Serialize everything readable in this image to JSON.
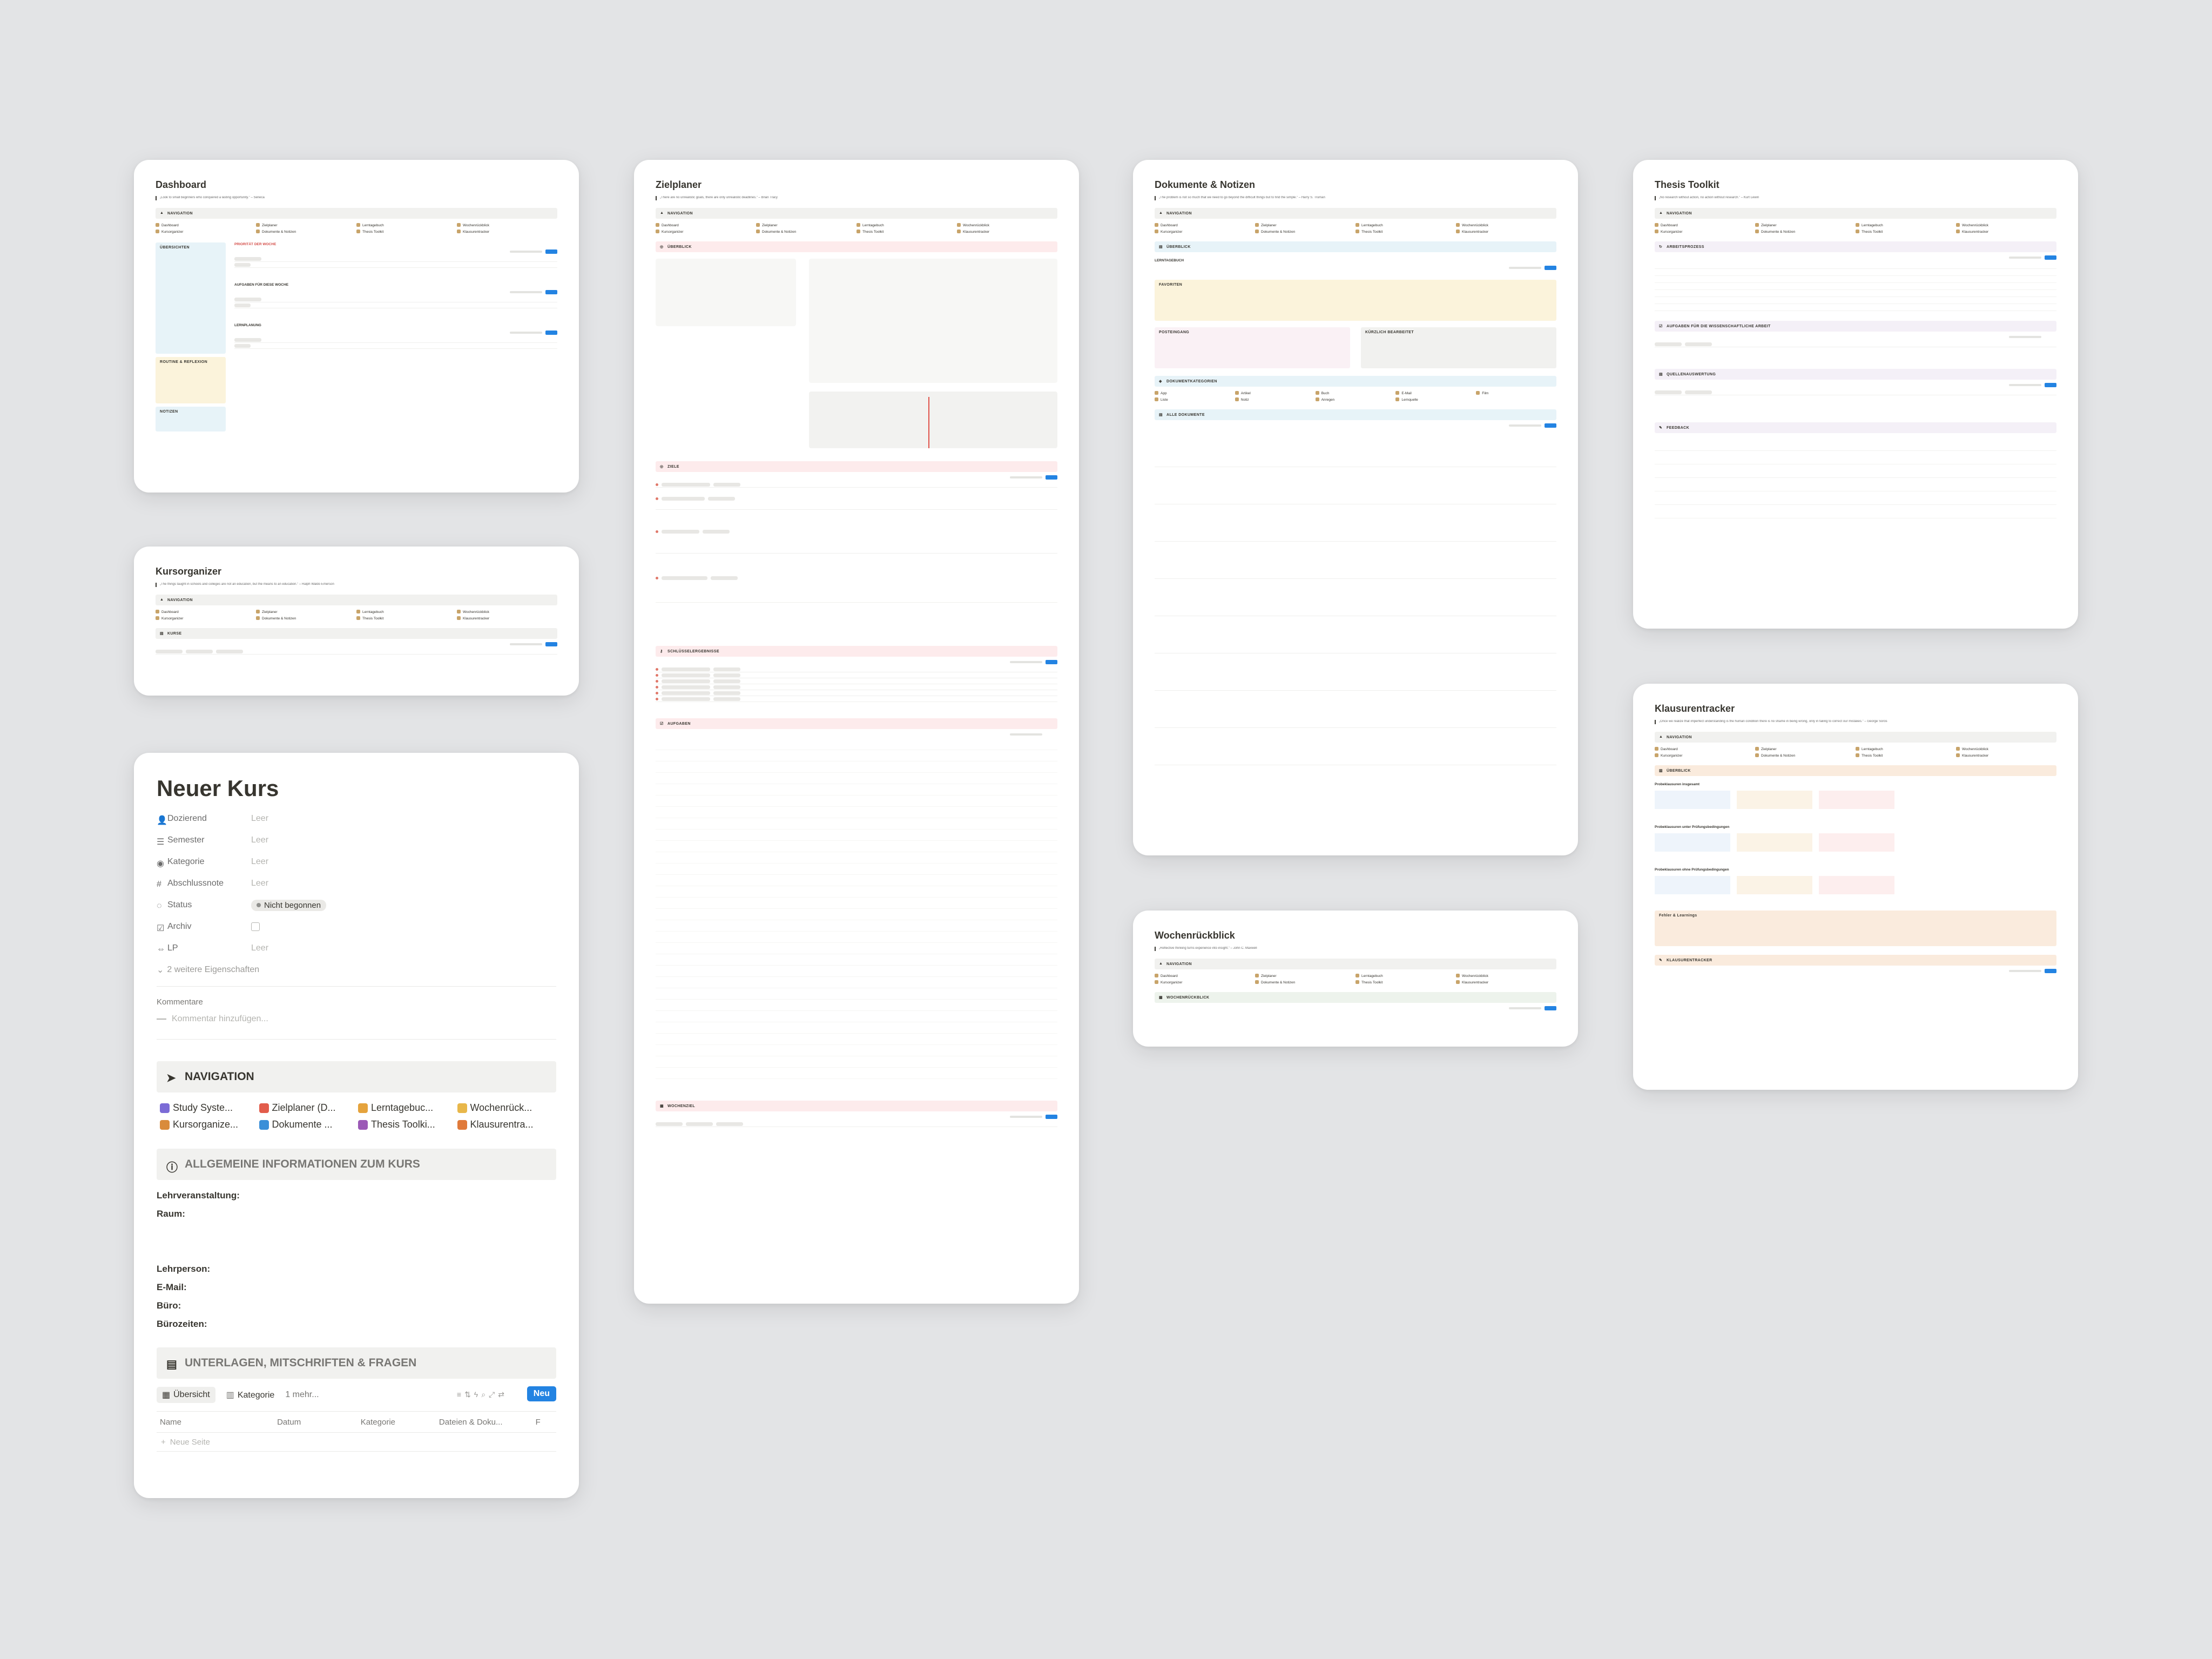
{
  "navigation_labels": [
    "Dashboard",
    "Zielplaner",
    "Lerntagebuch",
    "Wochenrückblick",
    "Kursorganizer",
    "Dokumente & Notizen",
    "Thesis Toolkit",
    "Klausurentracker"
  ],
  "cards": {
    "dashboard": {
      "title": "Dashboard",
      "quote": "„Look to small beginners who conquered a lasting opportunity.\" – Seneca",
      "nav_band": "NAVIGATION",
      "section_prio": "PRIORITÄT DER WOCHE",
      "section_tasks": "AUFGABEN FÜR DIESE WOCHE",
      "section_study": "LERNPLANUNG",
      "sidebar_a": "ÜBERSICHTEN",
      "sidebar_b": "ROUTINE & REFLEXION",
      "sidebar_c": "NOTIZEN"
    },
    "kursorganizer": {
      "title": "Kursorganizer",
      "quote": "„The things taught in schools and colleges are not an education, but the means to an education.\" – Ralph Waldo Emerson",
      "nav_band": "NAVIGATION",
      "section": "KURSE"
    },
    "neuer_kurs": {
      "title": "Neuer Kurs",
      "properties": [
        {
          "key": "Dozierend",
          "value": "Leer"
        },
        {
          "key": "Semester",
          "value": "Leer"
        },
        {
          "key": "Kategorie",
          "value": "Leer"
        },
        {
          "key": "Abschlussnote",
          "value": "Leer"
        },
        {
          "key": "Status",
          "value": "Nicht begonnen"
        },
        {
          "key": "Archiv",
          "value": ""
        },
        {
          "key": "LP",
          "value": "Leer"
        }
      ],
      "more_props": "2 weitere Eigenschaften",
      "comments_label": "Kommentare",
      "comment_placeholder": "Kommentar hinzufügen...",
      "nav_title": "NAVIGATION",
      "nav_items": [
        "Study Syste...",
        "Zielplaner (D...",
        "Lerntagebuc...",
        "Wochenrück...",
        "Kursorganize...",
        "Dokumente ...",
        "Thesis Toolki...",
        "Klausurentra..."
      ],
      "info_title": "ALLGEMEINE INFORMATIONEN ZUM KURS",
      "info_lines": [
        "Lehrveranstaltung:",
        "Raum:",
        "",
        "",
        "Lehrperson:",
        "E-Mail:",
        "Büro:",
        "Bürozeiten:"
      ],
      "docs_title": "UNTERLAGEN, MITSCHRIFTEN & FRAGEN",
      "tab_overview": "Übersicht",
      "tab_category": "Kategorie",
      "tab_more": "1 mehr...",
      "new_button": "Neu",
      "columns": [
        "Name",
        "Datum",
        "Kategorie",
        "Dateien & Doku...",
        "F"
      ],
      "new_page": "Neue Seite"
    },
    "zielplaner": {
      "title": "Zielplaner",
      "quote": "„There are no unrealistic goals, there are only unrealistic deadlines.\" – Brian Tracy",
      "nav_band": "NAVIGATION",
      "section_overview": "ÜBERBLICK",
      "section_goals": "ZIELE",
      "section_milestones": "SCHLÜSSELERGEBNISSE",
      "section_tasks": "AUFGABEN",
      "section_habits": "WOCHENZIEL"
    },
    "dokumente": {
      "title": "Dokumente & Notizen",
      "quote": "„The problem is not so much that we need to go beyond the difficult things but to find the simple.\" – Harry S. Truman",
      "nav_band": "NAVIGATION",
      "section_overview": "ÜBERBLICK",
      "sub_learning": "LERNTAGEBUCH",
      "sub_favorites": "FAVORITEN",
      "sub_inbox": "POSTEINGANG",
      "sub_recent": "KÜRZLICH BEARBEITET",
      "section_types": "DOKUMENTKATEGORIEN",
      "section_all": "ALLE DOKUMENTE",
      "groups": [
        "App",
        "Artikel",
        "Buch",
        "E-Mail",
        "Film",
        "Liste",
        "Notiz",
        "Anregen",
        "Lernquelle",
        "Lernquelle"
      ]
    },
    "wochen": {
      "title": "Wochenrückblick",
      "quote": "„Reflective thinking turns experience into insight.\" – John C. Maxwell",
      "nav_band": "NAVIGATION",
      "section": "WOCHENRÜCKBLICK"
    },
    "thesis": {
      "title": "Thesis Toolkit",
      "quote": "„No research without action, no action without research.\" – Kurt Lewin",
      "nav_band": "NAVIGATION",
      "section_process": "ARBEITSPROZESS",
      "section_tasks": "AUFGABEN FÜR DIE WISSENSCHAFTLICHE ARBEIT",
      "section_sources": "QUELLENAUSWERTUNG",
      "section_feedback": "FEEDBACK"
    },
    "klausur": {
      "title": "Klausurentracker",
      "quote": "„Once we realize that imperfect understanding is the human condition there is no shame in being wrong, only in failing to correct our mistakes.\" – George Soros",
      "nav_band": "NAVIGATION",
      "section_overview": "ÜBERBLICK",
      "sub_a": "Probeklausuren insgesamt",
      "sub_b": "Probeklausuren unter Prüfungsbedingungen",
      "sub_c": "Probeklausuren ohne Prüfungsbedingungen",
      "sub_errors": "Fehler & Learnings",
      "section_tracker": "KLAUSURENTRACKER"
    }
  },
  "colors": {
    "accent": "#2383e2",
    "page_bg": "#e3e4e6",
    "card_bg": "#ffffff"
  }
}
